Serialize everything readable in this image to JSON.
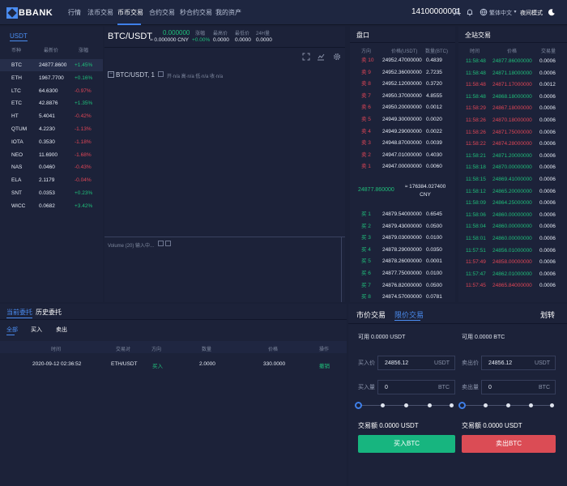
{
  "header": {
    "logo": "BBANK",
    "nav": [
      "行情",
      "法币交易",
      "币币交易",
      "合约交易",
      "秒合约交易",
      "我的资产"
    ],
    "account": "14100000001",
    "language": "繁体中文",
    "mode": "夜间模式"
  },
  "market": {
    "tab": "USDT",
    "headers": [
      "币种",
      "最新价",
      "涨幅"
    ],
    "rows": [
      {
        "coin": "BTC",
        "price": "24877.8600",
        "change": "+1.45%",
        "dir": "up"
      },
      {
        "coin": "ETH",
        "price": "1967.7700",
        "change": "+0.16%",
        "dir": "up"
      },
      {
        "coin": "LTC",
        "price": "64.6300",
        "change": "-0.97%",
        "dir": "dn"
      },
      {
        "coin": "ETC",
        "price": "42.8876",
        "change": "+1.35%",
        "dir": "up"
      },
      {
        "coin": "HT",
        "price": "5.4041",
        "change": "-0.42%",
        "dir": "dn"
      },
      {
        "coin": "QTUM",
        "price": "4.2230",
        "change": "-1.13%",
        "dir": "dn"
      },
      {
        "coin": "IOTA",
        "price": "0.3530",
        "change": "-1.18%",
        "dir": "dn"
      },
      {
        "coin": "NEO",
        "price": "11.6900",
        "change": "-1.68%",
        "dir": "dn"
      },
      {
        "coin": "NAS",
        "price": "0.0460",
        "change": "-0.43%",
        "dir": "dn"
      },
      {
        "coin": "ELA",
        "price": "2.1179",
        "change": "-0.04%",
        "dir": "dn"
      },
      {
        "coin": "SNT",
        "price": "0.0353",
        "change": "+0.23%",
        "dir": "up"
      },
      {
        "coin": "WICC",
        "price": "0.0682",
        "change": "+3.42%",
        "dir": "up"
      }
    ]
  },
  "ticker": {
    "pair": "BTC/USDT",
    "price": "0.000000",
    "cny": "≈ 0.000000 CNY",
    "labels": [
      "涨幅",
      "最高价",
      "最低价",
      "24H量"
    ],
    "values": [
      "+0.00%",
      "0.0000",
      "0.0000",
      "0.0000"
    ]
  },
  "chart": {
    "legend": "BTC/USDT, 1",
    "ohlc": "开∙n/a 高∙n/a 低∙n/a 收∙n/a",
    "volume": "Volume (20) 输入中..."
  },
  "orderbook": {
    "title": "盘口",
    "headers": [
      "方向",
      "价格(USDT)",
      "数量(BTC)"
    ],
    "asks": [
      {
        "side": "卖 10",
        "price": "24952.47000000",
        "qty": "0.4839"
      },
      {
        "side": "卖 9",
        "price": "24952.36000000",
        "qty": "2.7235"
      },
      {
        "side": "卖 8",
        "price": "24952.12000000",
        "qty": "0.3720"
      },
      {
        "side": "卖 7",
        "price": "24950.37000000",
        "qty": "4.8555"
      },
      {
        "side": "卖 6",
        "price": "24950.20000000",
        "qty": "0.0012"
      },
      {
        "side": "卖 5",
        "price": "24949.30000000",
        "qty": "0.0020"
      },
      {
        "side": "卖 4",
        "price": "24949.29000000",
        "qty": "0.0022"
      },
      {
        "side": "卖 3",
        "price": "24948.87000000",
        "qty": "0.0039"
      },
      {
        "side": "卖 2",
        "price": "24947.01000000",
        "qty": "0.4030"
      },
      {
        "side": "卖 1",
        "price": "24947.00000000",
        "qty": "0.0060"
      }
    ],
    "last_price": "24877.860000",
    "last_cny": "≈ 176384.027400 CNY",
    "bids": [
      {
        "side": "买 1",
        "price": "24879.54000000",
        "qty": "0.6545"
      },
      {
        "side": "买 2",
        "price": "24879.43000000",
        "qty": "0.0500"
      },
      {
        "side": "买 3",
        "price": "24879.03000000",
        "qty": "0.0100"
      },
      {
        "side": "买 4",
        "price": "24878.29000000",
        "qty": "0.0350"
      },
      {
        "side": "买 5",
        "price": "24878.26000000",
        "qty": "0.0001"
      },
      {
        "side": "买 6",
        "price": "24877.75000000",
        "qty": "0.0100"
      },
      {
        "side": "买 7",
        "price": "24876.82000000",
        "qty": "0.0500"
      },
      {
        "side": "买 8",
        "price": "24874.57000000",
        "qty": "0.0781"
      }
    ]
  },
  "trades": {
    "title": "全站交易",
    "headers": [
      "时间",
      "价格",
      "交易量"
    ],
    "rows": [
      {
        "time": "11:58:48",
        "price": "24877.86000000",
        "qty": "0.0006",
        "dir": "up"
      },
      {
        "time": "11:58:48",
        "price": "24871.18000000",
        "qty": "0.0006",
        "dir": "up"
      },
      {
        "time": "11:58:48",
        "price": "24871.17000000",
        "qty": "0.0012",
        "dir": "dn"
      },
      {
        "time": "11:58:48",
        "price": "24868.18000000",
        "qty": "0.0006",
        "dir": "up"
      },
      {
        "time": "11:58:29",
        "price": "24867.18000000",
        "qty": "0.0006",
        "dir": "dn"
      },
      {
        "time": "11:58:26",
        "price": "24870.18000000",
        "qty": "0.0006",
        "dir": "dn"
      },
      {
        "time": "11:58:26",
        "price": "24871.75000000",
        "qty": "0.0006",
        "dir": "dn"
      },
      {
        "time": "11:58:22",
        "price": "24874.28000000",
        "qty": "0.0006",
        "dir": "dn"
      },
      {
        "time": "11:58:21",
        "price": "24871.20000000",
        "qty": "0.0006",
        "dir": "up"
      },
      {
        "time": "11:58:18",
        "price": "24870.00000000",
        "qty": "0.0006",
        "dir": "up"
      },
      {
        "time": "11:58:15",
        "price": "24869.41000000",
        "qty": "0.0006",
        "dir": "up"
      },
      {
        "time": "11:58:12",
        "price": "24865.20000000",
        "qty": "0.0006",
        "dir": "up"
      },
      {
        "time": "11:58:09",
        "price": "24864.25000000",
        "qty": "0.0006",
        "dir": "up"
      },
      {
        "time": "11:58:06",
        "price": "24860.00000000",
        "qty": "0.0006",
        "dir": "up"
      },
      {
        "time": "11:58:04",
        "price": "24860.00000000",
        "qty": "0.0006",
        "dir": "up"
      },
      {
        "time": "11:58:01",
        "price": "24860.00000000",
        "qty": "0.0006",
        "dir": "up"
      },
      {
        "time": "11:57:51",
        "price": "24856.01000000",
        "qty": "0.0006",
        "dir": "up"
      },
      {
        "time": "11:57:49",
        "price": "24858.00000000",
        "qty": "0.0006",
        "dir": "dn"
      },
      {
        "time": "11:57:47",
        "price": "24862.01000000",
        "qty": "0.0006",
        "dir": "up"
      },
      {
        "time": "11:57:45",
        "price": "24865.84000000",
        "qty": "0.0006",
        "dir": "dn"
      }
    ]
  },
  "orders": {
    "tabs": [
      "当前委托",
      "历史委托"
    ],
    "filters": [
      "全部",
      "买入",
      "卖出"
    ],
    "headers": [
      "时间",
      "交易对",
      "方向",
      "数量",
      "价格",
      "操作"
    ],
    "rows": [
      {
        "time": "2020-09-12 02:36:52",
        "pair": "ETH/USDT",
        "side": "买入",
        "qty": "2.0000",
        "price": "330.0000",
        "action": "撤销"
      }
    ]
  },
  "form": {
    "tabs": [
      "市价交易",
      "限价交易"
    ],
    "transfer": "划转",
    "buy": {
      "available": "可用 0.0000 USDT",
      "price_label": "买入价",
      "price": "24856.12",
      "price_unit": "USDT",
      "qty_label": "买入量",
      "qty": "0",
      "qty_unit": "BTC",
      "amount": "交易额 0.0000 USDT",
      "button": "买入BTC"
    },
    "sell": {
      "available": "可用 0.0000 BTC",
      "price_label": "卖出价",
      "price": "24856.12",
      "price_unit": "USDT",
      "qty_label": "卖出量",
      "qty": "0",
      "qty_unit": "BTC",
      "amount": "交易额 0.0000 USDT",
      "button": "卖出BTC"
    }
  },
  "colors": {
    "up": "#1fbf7a",
    "down": "#e04656",
    "accent": "#3f7fe8",
    "buy_button": "#17b57f",
    "sell_button": "#db4c55"
  },
  "icons": [
    "user-icon",
    "bell-icon",
    "globe-icon",
    "moon-icon",
    "fullscreen-icon",
    "indicator-icon",
    "settings-icon"
  ]
}
